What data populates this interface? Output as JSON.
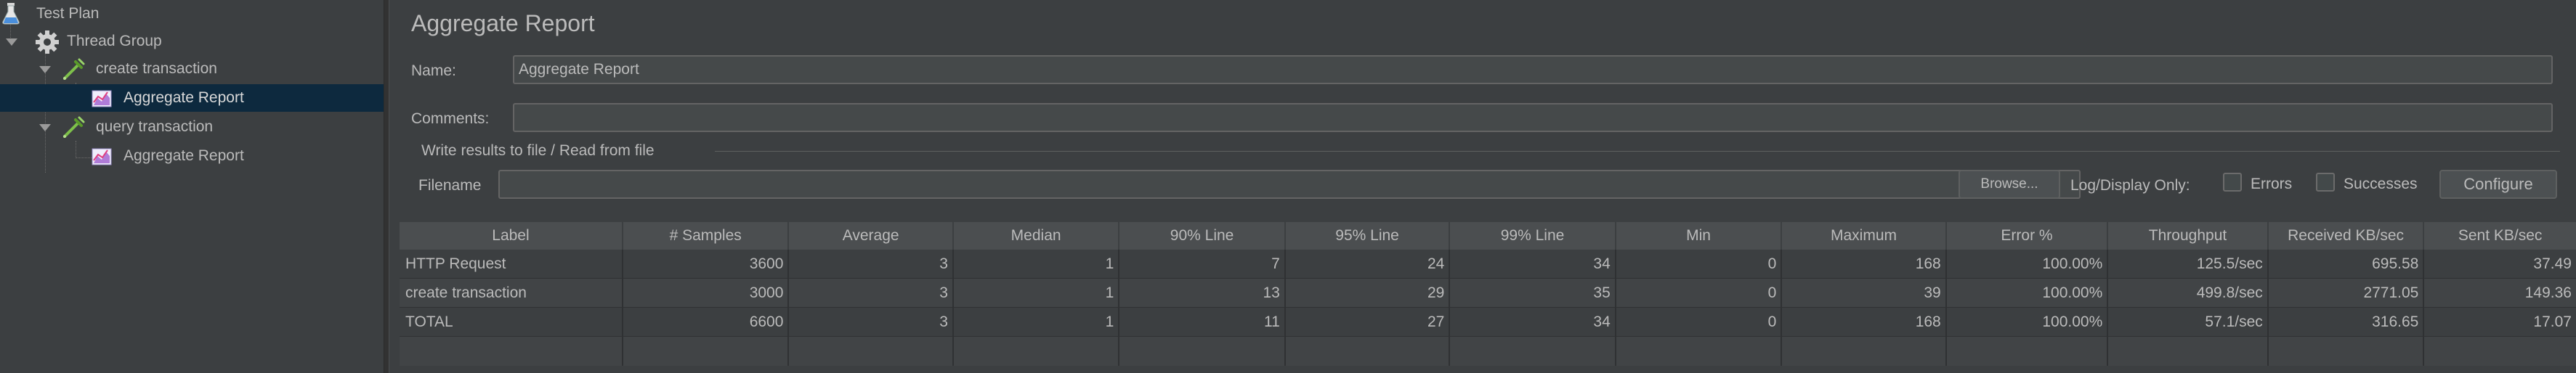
{
  "tree": {
    "items": [
      {
        "label": "Test Plan",
        "icon": "flask-icon"
      },
      {
        "label": "Thread Group",
        "icon": "gear-icon"
      },
      {
        "label": "create transaction",
        "icon": "pipette-icon"
      },
      {
        "label": "Aggregate Report",
        "icon": "chart-icon"
      },
      {
        "label": "query transaction",
        "icon": "pipette-icon"
      },
      {
        "label": "Aggregate Report",
        "icon": "chart-icon"
      }
    ]
  },
  "panel": {
    "title": "Aggregate Report",
    "name_label": "Name:",
    "name_value": "Aggregate Report",
    "comments_label": "Comments:",
    "comments_value": "",
    "file_group_label": "Write results to file / Read from file",
    "filename_label": "Filename",
    "filename_value": "",
    "browse_label": "Browse...",
    "log_display_label": "Log/Display Only:",
    "errors_label": "Errors",
    "successes_label": "Successes",
    "configure_label": "Configure"
  },
  "table": {
    "columns": [
      "Label",
      "# Samples",
      "Average",
      "Median",
      "90% Line",
      "95% Line",
      "99% Line",
      "Min",
      "Maximum",
      "Error %",
      "Throughput",
      "Received KB/sec",
      "Sent KB/sec"
    ],
    "rows": [
      [
        "HTTP Request",
        "3600",
        "3",
        "1",
        "7",
        "24",
        "34",
        "0",
        "168",
        "100.00%",
        "125.5/sec",
        "695.58",
        "37.49"
      ],
      [
        "create transaction",
        "3000",
        "3",
        "1",
        "13",
        "29",
        "35",
        "0",
        "39",
        "100.00%",
        "499.8/sec",
        "2771.05",
        "149.36"
      ],
      [
        "TOTAL",
        "6600",
        "3",
        "1",
        "11",
        "27",
        "34",
        "0",
        "168",
        "100.00%",
        "57.1/sec",
        "316.65",
        "17.07"
      ]
    ]
  },
  "colors": {
    "background": "#3c3f41",
    "selection": "#0d293e",
    "header": "#4b4e50",
    "text": "#bbbbbb"
  }
}
